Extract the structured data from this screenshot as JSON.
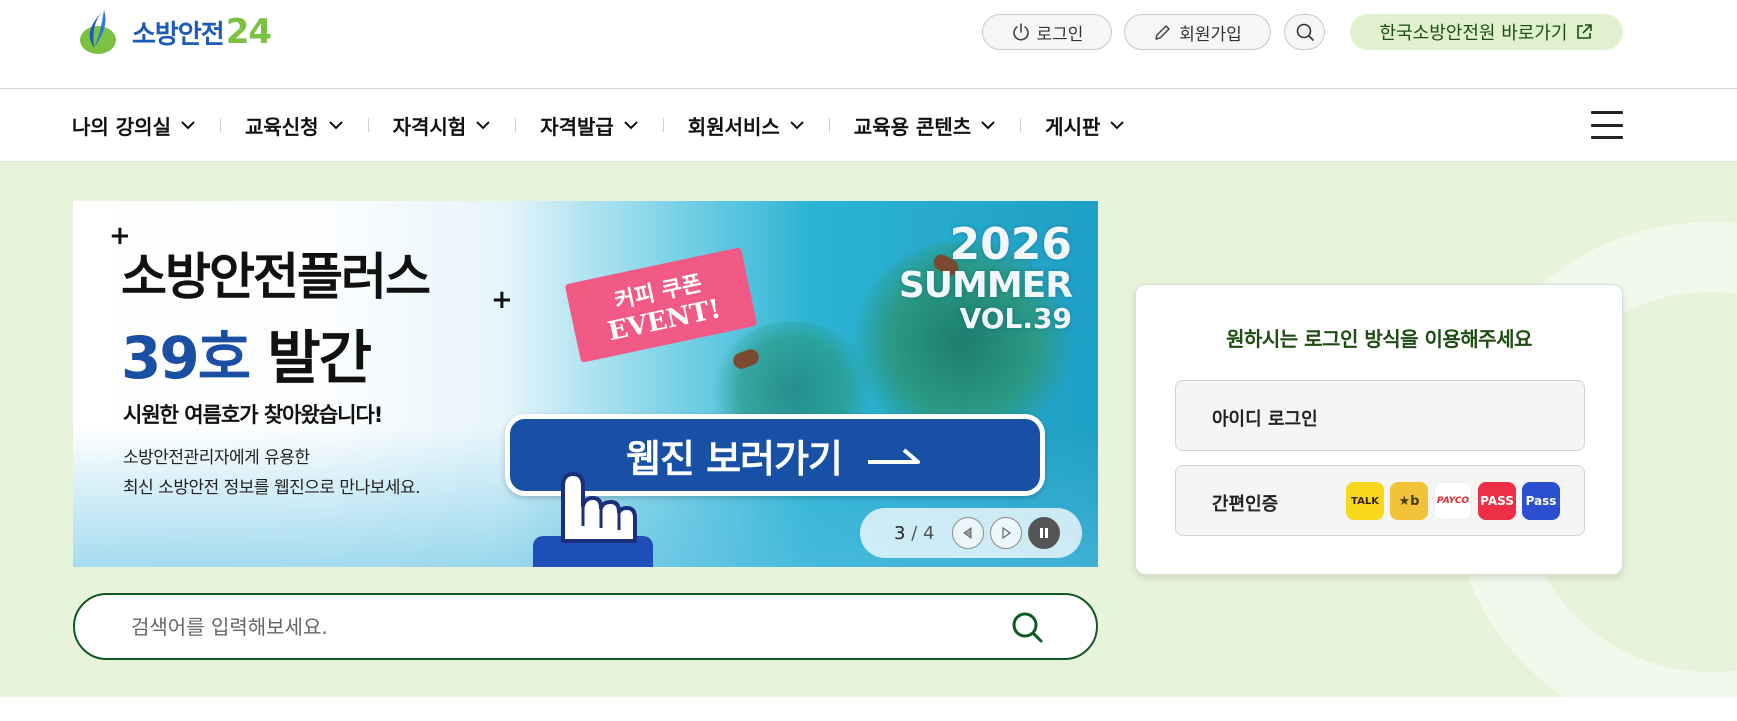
{
  "header": {
    "logo_text": "소방안전",
    "logo_number": "24",
    "login_label": "로그인",
    "join_label": "회원가입",
    "kfsi_link_label": "한국소방안전원 바로가기"
  },
  "gnb": {
    "items": [
      {
        "label": "나의 강의실"
      },
      {
        "label": "교육신청"
      },
      {
        "label": "자격시험"
      },
      {
        "label": "자격발급"
      },
      {
        "label": "회원서비스"
      },
      {
        "label": "교육용 콘텐츠"
      },
      {
        "label": "게시판"
      }
    ]
  },
  "banner": {
    "title": "소방안전플러스",
    "issue_number": "39호",
    "issue_suffix": "발간",
    "subtitle": "시원한 여름호가 찾아왔습니다!",
    "desc_line1": "소방안전관리자에게 유용한",
    "desc_line2": "최신 소방안전 정보를 웹진으로 만나보세요.",
    "year": "2026",
    "season": "SUMMER",
    "volume": "VOL.39",
    "ticket_line1": "커피 쿠폰",
    "ticket_line2": "EVENT!",
    "button_label": "웹진 보러가기",
    "pager_current": "3",
    "pager_total": "4",
    "pager_separator": "/"
  },
  "search": {
    "placeholder": "검색어를 입력해보세요."
  },
  "login_card": {
    "title": "원하시는 로그인 방식을 이용해주세요",
    "id_login_label": "아이디 로그인",
    "easy_auth_label": "간편인증",
    "providers": [
      {
        "name": "kakao",
        "label": "TALK",
        "color": "#f8d81c"
      },
      {
        "name": "kb",
        "label": "★b",
        "color": "#f2c338"
      },
      {
        "name": "payco",
        "label": "PAYCO",
        "color": "#ffffff"
      },
      {
        "name": "pass",
        "label": "PASS",
        "color": "#ec2f47"
      },
      {
        "name": "pass-blue",
        "label": "Pass",
        "color": "#2a4fcf"
      }
    ]
  },
  "colors": {
    "brand_green": "#7cc242",
    "brand_blue": "#1c5bb8",
    "hero_bg": "#e7f3da",
    "search_border": "#0f5a22"
  }
}
